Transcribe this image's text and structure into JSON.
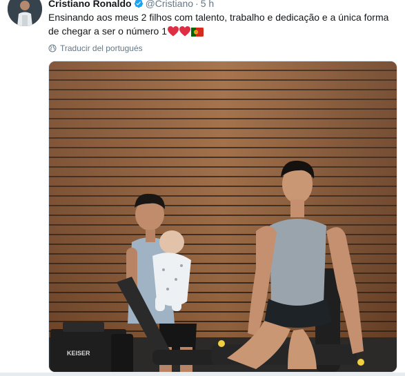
{
  "tweet": {
    "author_name": "Cristiano Ronaldo",
    "handle": "@Cristiano",
    "separator": "·",
    "time": "5 h",
    "text": "Ensinando aos meus 2 filhos com talento, trabalho e dedicação e a única forma de chegar a ser o número 1",
    "emojis": [
      "red-heart-emoji",
      "red-heart-emoji",
      "portugal-flag-emoji"
    ],
    "translate_label": "Traducir del portugués"
  },
  "media_labels": {
    "equipment_brand": "KEISER"
  },
  "colors": {
    "verified": "#1da1f2",
    "secondary_text": "#657786",
    "primary_text": "#14171a",
    "heart": "#e0245e"
  }
}
